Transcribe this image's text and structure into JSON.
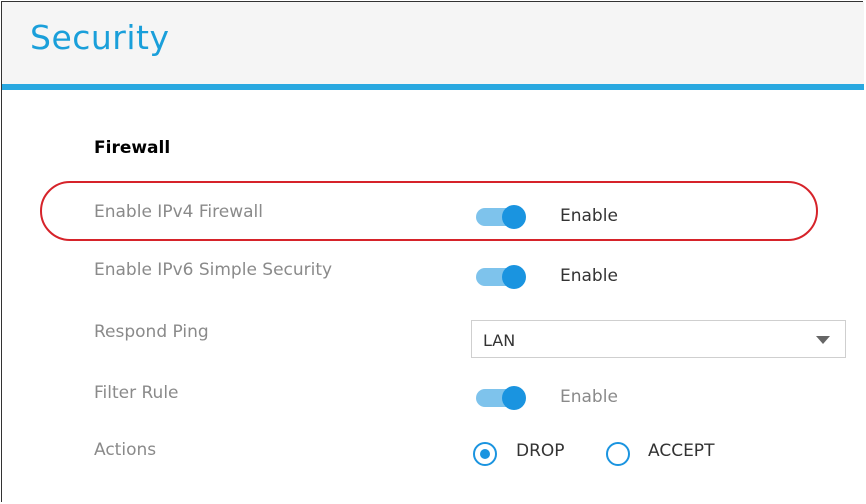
{
  "page": {
    "title": "Security"
  },
  "firewall": {
    "section_title": "Firewall",
    "rows": {
      "ipv4": {
        "label": "Enable IPv4 Firewall",
        "toggle_text": "Enable",
        "enabled": true
      },
      "ipv6": {
        "label": "Enable IPv6 Simple Security",
        "toggle_text": "Enable",
        "enabled": true
      },
      "respond_ping": {
        "label": "Respond Ping",
        "value": "LAN"
      },
      "filter_rule": {
        "label": "Filter Rule",
        "toggle_text": "Enable",
        "enabled": true
      },
      "actions": {
        "label": "Actions",
        "options": [
          {
            "label": "DROP",
            "selected": true
          },
          {
            "label": "ACCEPT",
            "selected": false
          }
        ]
      }
    }
  },
  "colors": {
    "accent": "#29a8e0",
    "toggle_on": "#1a94e0",
    "highlight": "#d6232a"
  }
}
